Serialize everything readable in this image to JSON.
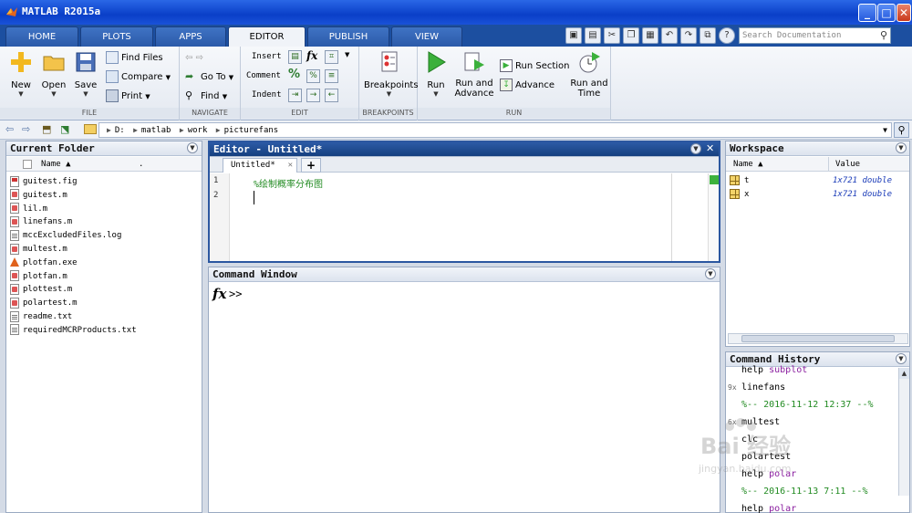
{
  "window": {
    "title": "MATLAB R2015a",
    "minimize": "_",
    "maximize": "□",
    "close": "✕"
  },
  "tabs": [
    {
      "label": "HOME"
    },
    {
      "label": "PLOTS"
    },
    {
      "label": "APPS"
    },
    {
      "label": "EDITOR"
    },
    {
      "label": "PUBLISH"
    },
    {
      "label": "VIEW"
    }
  ],
  "search_doc": {
    "placeholder": "Search Documentation"
  },
  "ribbon": {
    "file": {
      "label": "FILE",
      "new": "New",
      "open": "Open",
      "save": "Save",
      "find_files": "Find Files",
      "compare": "Compare",
      "print": "Print"
    },
    "navigate": {
      "label": "NAVIGATE",
      "goto": "Go To",
      "find": "Find"
    },
    "edit": {
      "label": "EDIT",
      "insert": "Insert",
      "comment": "Comment",
      "indent": "Indent",
      "fx": "fx",
      "pct": "%"
    },
    "breakpoints": {
      "label": "BREAKPOINTS",
      "breakpoints": "Breakpoints"
    },
    "run": {
      "label": "RUN",
      "run": "Run",
      "run_advance_1": "Run and",
      "run_advance_2": "Advance",
      "run_section": "Run Section",
      "advance": "Advance",
      "run_time_1": "Run and",
      "run_time_2": "Time"
    }
  },
  "address": {
    "segments": [
      "D:",
      "matlab",
      "work",
      "picturefans"
    ]
  },
  "current_folder": {
    "title": "Current Folder",
    "col_name": "Name ▲",
    "col_dot": ".",
    "files": [
      {
        "name": "guitest.fig",
        "type": "fig"
      },
      {
        "name": "guitest.m",
        "type": "m"
      },
      {
        "name": "lil.m",
        "type": "m"
      },
      {
        "name": "linefans.m",
        "type": "m"
      },
      {
        "name": "mccExcludedFiles.log",
        "type": "txt"
      },
      {
        "name": "multest.m",
        "type": "m"
      },
      {
        "name": "plotfan.exe",
        "type": "exe"
      },
      {
        "name": "plotfan.m",
        "type": "m"
      },
      {
        "name": "plottest.m",
        "type": "m"
      },
      {
        "name": "polartest.m",
        "type": "m"
      },
      {
        "name": "readme.txt",
        "type": "txt"
      },
      {
        "name": "requiredMCRProducts.txt",
        "type": "txt"
      }
    ]
  },
  "editor": {
    "title": "Editor - Untitled*",
    "tab": "Untitled*",
    "tab_close": "✕",
    "plus": "+",
    "lines": [
      "1",
      "2"
    ],
    "code": "%绘制概率分布图"
  },
  "command_window": {
    "title": "Command Window",
    "fx": "fx",
    "prompt": ">>"
  },
  "workspace": {
    "title": "Workspace",
    "col_name": "Name ▲",
    "col_value": "Value",
    "vars": [
      {
        "name": "t",
        "value": "1x721 double"
      },
      {
        "name": "x",
        "value": "1x721 double"
      }
    ]
  },
  "history": {
    "title": "Command History",
    "rows": [
      {
        "count": "",
        "cmd": "help ",
        "arg": "subplot",
        "kind": "cmd"
      },
      {
        "count": "9x",
        "cmd": "linefans",
        "arg": "",
        "kind": "cmd"
      },
      {
        "count": "",
        "cmd": "%-- 2016-11-12 12:37 --%",
        "arg": "",
        "kind": "sep"
      },
      {
        "count": "6x",
        "cmd": "multest",
        "arg": "",
        "kind": "cmd"
      },
      {
        "count": "",
        "cmd": "clc",
        "arg": "",
        "kind": "cmd"
      },
      {
        "count": "",
        "cmd": "polartest",
        "arg": "",
        "kind": "cmd"
      },
      {
        "count": "",
        "cmd": "help ",
        "arg": "polar",
        "kind": "cmd"
      },
      {
        "count": "",
        "cmd": "%-- 2016-11-13 7:11 --%",
        "arg": "",
        "kind": "sep"
      },
      {
        "count": "",
        "cmd": "help ",
        "arg": "polar",
        "kind": "cmd"
      }
    ]
  },
  "watermark": {
    "text": "Bai 经验",
    "url": "jingyan.baidu.com"
  }
}
